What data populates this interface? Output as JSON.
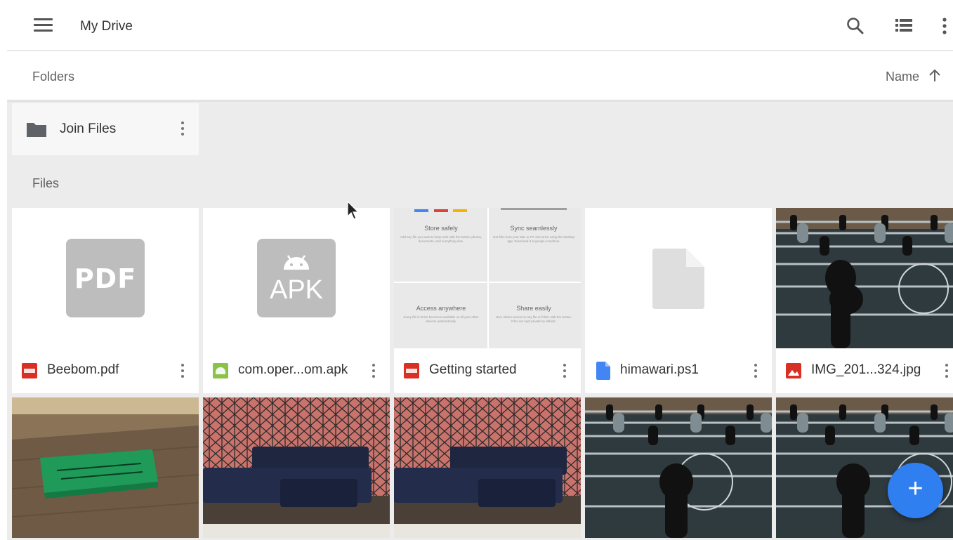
{
  "app": {
    "title": "My Drive"
  },
  "toolbar": {
    "icons": [
      "menu-icon",
      "search-icon",
      "list-view-icon",
      "more-vert-icon"
    ]
  },
  "sort": {
    "section_label": "Folders",
    "sort_field": "Name",
    "direction": "ascending"
  },
  "folders": [
    {
      "name": "Join Files"
    }
  ],
  "files_section": {
    "label": "Files"
  },
  "files": [
    {
      "name": "Beebom.pdf",
      "type": "pdf",
      "thumb_label": "PDF",
      "icon_color": "#d93025"
    },
    {
      "name": "com.oper...om.apk",
      "type": "apk",
      "thumb_label": "APK",
      "icon_color": "#8bc34a"
    },
    {
      "name": "Getting started",
      "type": "pdf",
      "icon_color": "#d93025",
      "preview": {
        "cells": [
          {
            "title": "Store safely",
            "text": "Add any file you want to keep safe with the button: photos, documents, and everything else."
          },
          {
            "title": "Sync seamlessly",
            "text": "Get files from your Mac or PC into Drive using the desktop app. Download it at google.com/drive."
          },
          {
            "title": "Access anywhere",
            "text": "Every file in Drive becomes available on all your other devices automatically."
          },
          {
            "title": "Share easily",
            "text": "Give others access to any file or folder with the button. Files are kept private by default."
          }
        ]
      }
    },
    {
      "name": "himawari.ps1",
      "type": "doc",
      "icon_color": "#4285f4"
    },
    {
      "name": "IMG_201...324.jpg",
      "type": "image",
      "icon_color": "#d93025"
    }
  ],
  "photos": [
    "green-block-photo",
    "lounge-sofa-photo",
    "lounge-sofa-photo",
    "foosball-photo",
    "foosball-photo"
  ],
  "fab": {
    "label": "+"
  }
}
